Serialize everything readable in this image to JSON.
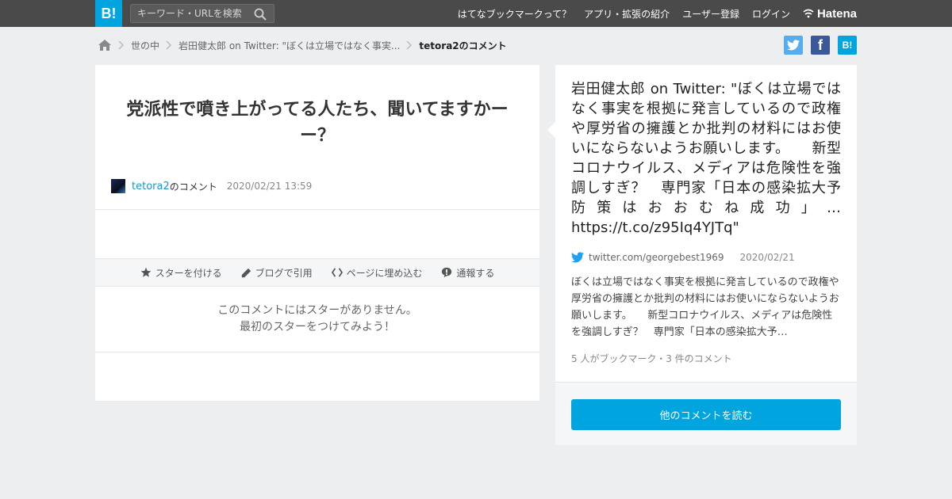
{
  "header": {
    "logo": "B!",
    "search_placeholder": "キーワード・URLを検索",
    "nav": [
      "はてなブックマークって？",
      "アプリ・拡張の紹介",
      "ユーザー登録",
      "ログイン"
    ],
    "brand": "Hatena"
  },
  "breadcrumb": {
    "items": [
      "世の中",
      "岩田健太郎 on Twitter: \"ぼくは立場ではなく事実..."
    ],
    "current": "tetora2のコメント"
  },
  "share": {
    "twitter_label": "twitter",
    "facebook_label": "f",
    "hatena_label": "B!",
    "colors": {
      "twitter": "#55acee",
      "facebook": "#3b5998",
      "hatena": "#00a4de"
    }
  },
  "comment": {
    "title": "党派性で噴き上がってる人たち、聞いてますかーー？",
    "username": "tetora2",
    "username_suffix": "のコメント",
    "date": "2020/02/21 13:59"
  },
  "actions": [
    "スターを付ける",
    "ブログで引用",
    "ページに埋め込む",
    "通報する"
  ],
  "stars": {
    "line1": "このコメントにはスターがありません。",
    "line2": "最初のスターをつけてみよう！"
  },
  "entry": {
    "title": "岩田健太郎 on Twitter: \"ぼくは立場ではなく事実を根拠に発言しているので政権や厚労省の擁護とか批判の材料にはお使いにならないようお願いします。　　新型コロナウイルス、メディアは危険性を強調しすぎ？　専門家「日本の感染拡大予防策はおおむね成功」… https://t.co/z95Iq4YJTq\"",
    "source": "twitter.com/georgebest1969",
    "date": "2020/02/21",
    "excerpt": "ぼくは立場ではなく事実を根拠に発言しているので政権や厚労省の擁護とか批判の材料にはお使いにならないようお願いします。　　新型コロナウイルス、メディアは危険性を強調しすぎ？　専門家「日本の感染拡大予…",
    "counts": "5 人がブックマーク・3 件のコメント"
  },
  "read_more": "他のコメントを読む",
  "colors": {
    "accent": "#00a4de",
    "topbar": "#4a4a4a",
    "link": "#1b95c6",
    "background": "#eceef0"
  }
}
